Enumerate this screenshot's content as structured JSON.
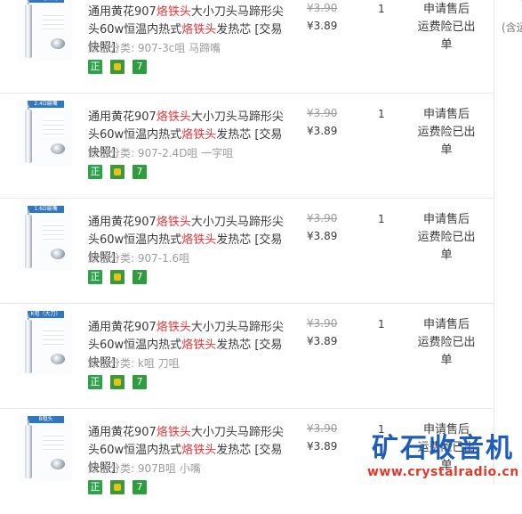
{
  "right_column": {
    "top_char": "¥",
    "text": "(含运"
  },
  "orders": [
    {
      "thumb_banner": "3C马蹄嘴",
      "title": [
        {
          "t": "通用黄花907"
        },
        {
          "t": "烙铁头",
          "hl": true
        },
        {
          "t": "大小刀头马蹄形尖头60w恒温内热式"
        },
        {
          "t": "烙铁头",
          "hl": true
        },
        {
          "t": "发热芯 [交易快照]"
        }
      ],
      "sku_label": "颜色分类:",
      "sku_value": "907-3c咀 马蹄嘴",
      "badges": {
        "zheng": "正",
        "bao": "",
        "qi": "7"
      },
      "orig_price": "¥3.90",
      "price": "¥3.89",
      "qty": "1",
      "after_sale": [
        "申请售后",
        "运费险已出单"
      ]
    },
    {
      "thumb_banner": "2.4D扁嘴",
      "title": [
        {
          "t": "通用黄花907"
        },
        {
          "t": "烙铁头",
          "hl": true
        },
        {
          "t": "大小刀头马蹄形尖头60w恒温内热式"
        },
        {
          "t": "烙铁头",
          "hl": true
        },
        {
          "t": "发热芯 [交易快照]"
        }
      ],
      "sku_label": "颜色分类:",
      "sku_value": "907-2.4D咀 一字咀",
      "badges": {
        "zheng": "正",
        "bao": "",
        "qi": "7"
      },
      "orig_price": "¥3.90",
      "price": "¥3.89",
      "qty": "1",
      "after_sale": [
        "申请售后",
        "运费险已出单"
      ]
    },
    {
      "thumb_banner": "1.6D扁嘴",
      "title": [
        {
          "t": "通用黄花907"
        },
        {
          "t": "烙铁头",
          "hl": true
        },
        {
          "t": "大小刀头马蹄形尖头60w恒温内热式"
        },
        {
          "t": "烙铁头",
          "hl": true
        },
        {
          "t": "发热芯 [交易快照]"
        }
      ],
      "sku_label": "颜色分类:",
      "sku_value": "907-1.6咀",
      "badges": {
        "zheng": "正",
        "bao": "",
        "qi": "7"
      },
      "orig_price": "¥3.90",
      "price": "¥3.89",
      "qty": "1",
      "after_sale": [
        "申请售后",
        "运费险已出单"
      ]
    },
    {
      "thumb_banner": "K咀（大刀）",
      "title": [
        {
          "t": "通用黄花907"
        },
        {
          "t": "烙铁头",
          "hl": true
        },
        {
          "t": "大小刀头马蹄形尖头60w恒温内热式"
        },
        {
          "t": "烙铁头",
          "hl": true
        },
        {
          "t": "发热芯 [交易快照]"
        }
      ],
      "sku_label": "颜色分类:",
      "sku_value": "k咀 刀咀",
      "badges": {
        "zheng": "正",
        "bao": "",
        "qi": "7"
      },
      "orig_price": "¥3.90",
      "price": "¥3.89",
      "qty": "1",
      "after_sale": [
        "申请售后",
        "运费险已出单"
      ]
    },
    {
      "thumb_banner": "B咀头",
      "title": [
        {
          "t": "通用黄花907"
        },
        {
          "t": "烙铁头",
          "hl": true
        },
        {
          "t": "大小刀头马蹄形尖头60w恒温内热式"
        },
        {
          "t": "烙铁头",
          "hl": true
        },
        {
          "t": "发热芯 [交易快照]"
        }
      ],
      "sku_label": "颜色分类:",
      "sku_value": "907B咀 小嘴",
      "badges": {
        "zheng": "正",
        "bao": "",
        "qi": "7"
      },
      "orig_price": "¥3.90",
      "price": "¥3.89",
      "qty": "1",
      "after_sale": [
        "申请售后",
        "运费险已出单"
      ]
    }
  ],
  "watermark": {
    "logo": "矿石收音机",
    "url": "www.crystalradio.cn"
  },
  "colors": {
    "highlight": "#e4393c",
    "badge_green": "#2ca249",
    "watermark_blue": "#1e5dbd",
    "watermark_red": "#e23a2a"
  }
}
